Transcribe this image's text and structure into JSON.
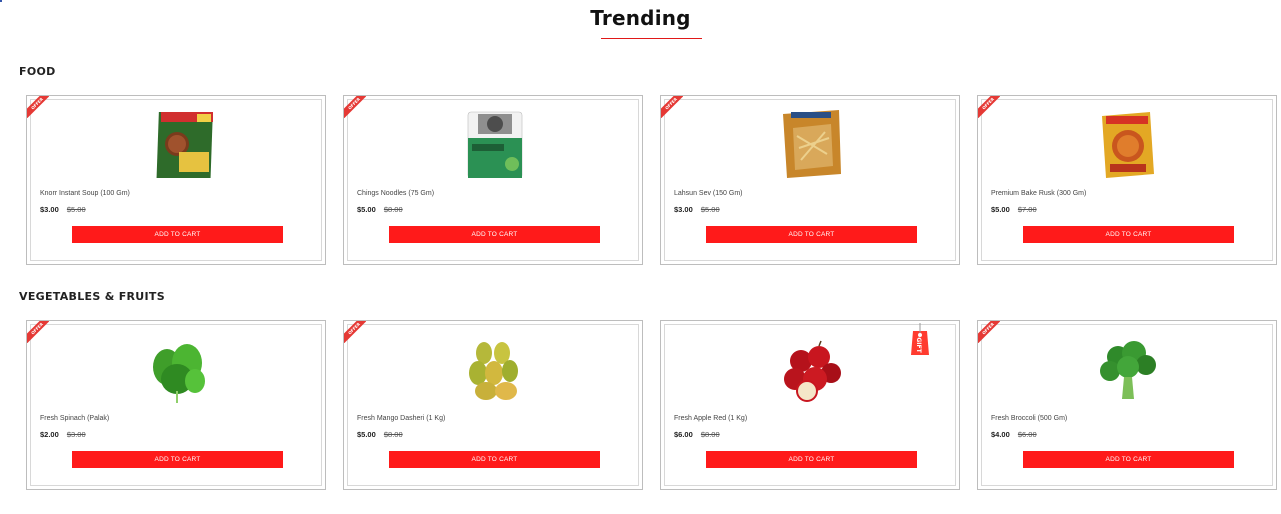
{
  "page_title": "Trending",
  "offer_label": "OFFER",
  "gift_label": "GIFT",
  "add_to_cart_label": "ADD TO CART",
  "sections": [
    {
      "heading": "FOOD",
      "products": [
        {
          "name": "Knorr Instant Soup (100 Gm)",
          "price": "$3.00",
          "old_price": "$5.00",
          "image": "soup-pack-icon",
          "badge": "offer"
        },
        {
          "name": "Chings Noodles (75 Gm)",
          "price": "$5.00",
          "old_price": "$8.00",
          "image": "noodles-pack-icon",
          "badge": "offer"
        },
        {
          "name": "Lahsun Sev (150 Gm)",
          "price": "$3.00",
          "old_price": "$5.00",
          "image": "snack-pack-icon",
          "badge": "offer"
        },
        {
          "name": "Premium Bake Rusk (300 Gm)",
          "price": "$5.00",
          "old_price": "$7.00",
          "image": "rusk-pack-icon",
          "badge": "offer"
        }
      ]
    },
    {
      "heading": "VEGETABLES & FRUITS",
      "products": [
        {
          "name": "Fresh Spinach (Palak)",
          "price": "$2.00",
          "old_price": "$3.00",
          "image": "spinach-icon",
          "badge": "offer"
        },
        {
          "name": "Fresh Mango Dasheri (1 Kg)",
          "price": "$5.00",
          "old_price": "$8.00",
          "image": "mango-icon",
          "badge": "offer"
        },
        {
          "name": "Fresh Apple Red (1 Kg)",
          "price": "$6.00",
          "old_price": "$8.00",
          "image": "apple-icon",
          "badge": "gift"
        },
        {
          "name": "Fresh Broccoli (500 Gm)",
          "price": "$4.00",
          "old_price": "$6.00",
          "image": "broccoli-icon",
          "badge": "offer"
        }
      ]
    }
  ],
  "colors": {
    "accent": "#ff1a1a",
    "underline": "#e01818",
    "card_border": "#bdbdbd"
  }
}
